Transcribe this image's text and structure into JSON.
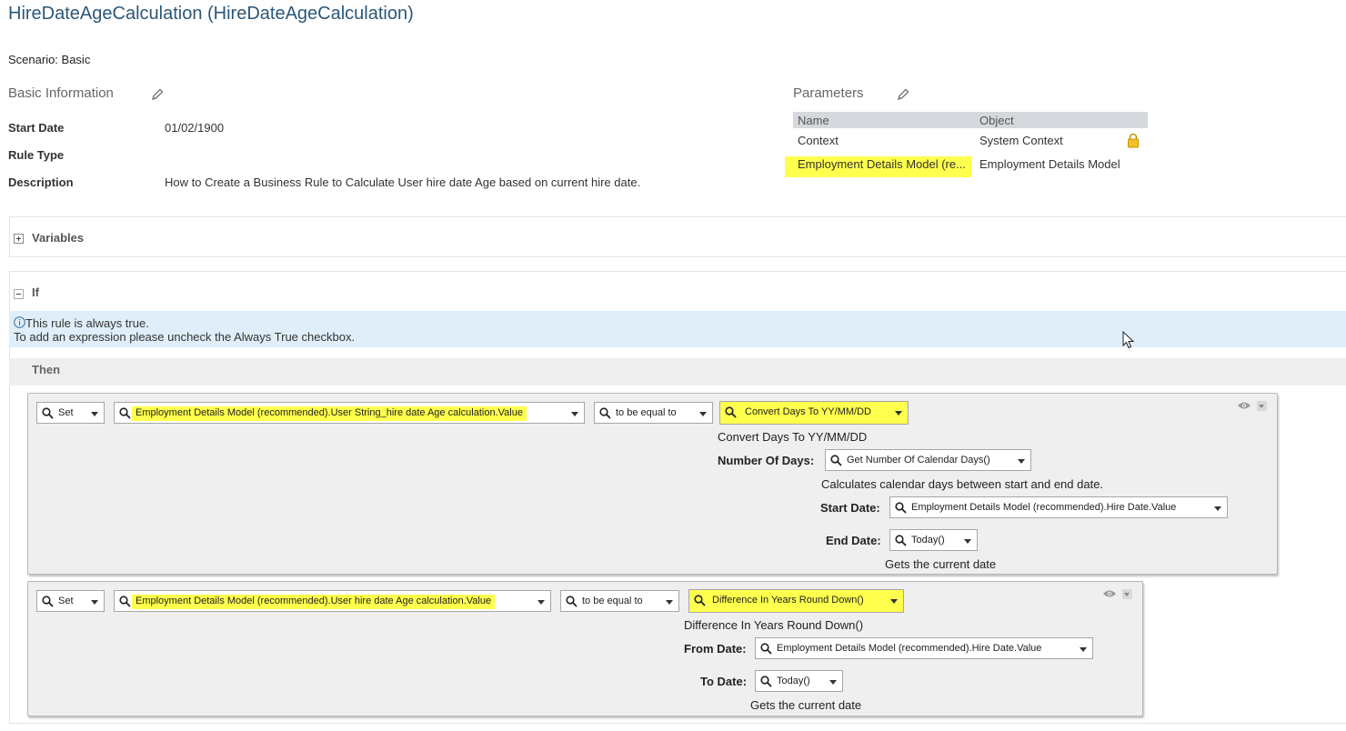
{
  "header": {
    "title": "HireDateAgeCalculation (HireDateAgeCalculation)",
    "scenario": "Scenario: Basic"
  },
  "basic_info": {
    "heading": "Basic Information",
    "fields": {
      "start_date_label": "Start Date",
      "start_date_value": "01/02/1900",
      "rule_type_label": "Rule Type",
      "rule_type_value": "",
      "description_label": "Description",
      "description_value": "How to Create a Business Rule to Calculate User hire date Age based on current hire date."
    }
  },
  "parameters": {
    "heading": "Parameters",
    "columns": [
      "Name",
      "Object"
    ],
    "rows": [
      {
        "name": "Context",
        "object": "System Context"
      },
      {
        "name": "Employment Details Model (re...",
        "object": "Employment Details Model"
      }
    ]
  },
  "variables": {
    "label": "Variables"
  },
  "if_section": {
    "label": "If",
    "info_line1": "This rule is always true.",
    "info_line2": "To add an expression please uncheck the Always True checkbox."
  },
  "then_section": {
    "label": "Then"
  },
  "rule1": {
    "action": "Set",
    "target": "Employment Details Model (recommended).User String_hire date Age calculation.Value",
    "operator": "to be equal to",
    "function": "Convert Days To YY/MM/DD",
    "function_desc": "Convert Days To YY/MM/DD",
    "param_label": "Number Of Days:",
    "param_value": "Get Number Of Calendar Days()",
    "param_desc": "Calculates calendar days between start and end date.",
    "start_label": "Start Date:",
    "start_value": "Employment Details Model (recommended).Hire Date.Value",
    "end_label": "End Date:",
    "end_value": "Today()",
    "end_desc": "Gets the current date"
  },
  "rule2": {
    "action": "Set",
    "target": "Employment Details Model (recommended).User hire date Age calculation.Value",
    "operator": "to be equal to",
    "function": "Difference In Years Round Down()",
    "function_desc": "Difference In Years Round Down()",
    "from_label": "From Date:",
    "from_value": "Employment Details Model (recommended).Hire Date.Value",
    "to_label": "To Date:",
    "to_value": "Today()",
    "to_desc": "Gets the current date"
  },
  "icons": [
    "pencil-icon",
    "lock-icon",
    "info-icon",
    "expand-icon",
    "collapse-icon",
    "search-icon",
    "dropdown-caret-icon",
    "eye-icon",
    "mouse-cursor-icon"
  ],
  "colors": {
    "title": "#2b5779",
    "highlight": "#ffff4d",
    "info_bg": "#dfeef8",
    "rule_bg": "#efefef",
    "lock": "#e8b200"
  }
}
